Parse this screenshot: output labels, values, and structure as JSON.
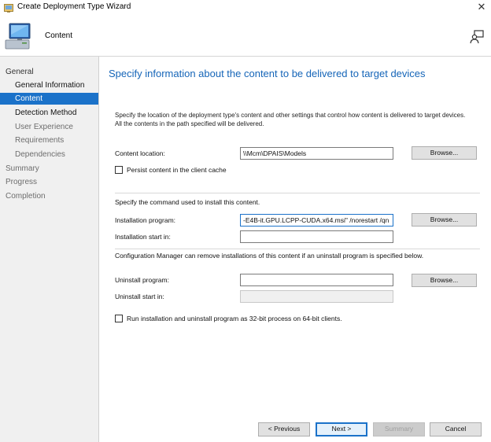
{
  "window": {
    "title": "Create Deployment Type Wizard",
    "close_glyph": "✕"
  },
  "header": {
    "title": "Content",
    "icon": "computer-icon",
    "assist_icon": "help-person-icon"
  },
  "sidebar": {
    "items": [
      {
        "label": "General"
      },
      {
        "label": "General Information"
      },
      {
        "label": "Content"
      },
      {
        "label": "Detection Method"
      },
      {
        "label": "User Experience"
      },
      {
        "label": "Requirements"
      },
      {
        "label": "Dependencies"
      },
      {
        "label": "Summary"
      },
      {
        "label": "Progress"
      },
      {
        "label": "Completion"
      }
    ],
    "active": "Content"
  },
  "main": {
    "heading": "Specify information about the content to be delivered to target devices",
    "description": "Specify the location of the deployment type's content and other settings that control how content is delivered to target devices. All the contents in the path specified will be delivered.",
    "content_location": {
      "label": "Content location:",
      "value": "\\\\Mcm\\DPAIS\\Models",
      "browse": "Browse..."
    },
    "persist_cache": {
      "label": "Persist content in the client cache",
      "checked": false
    },
    "install_section_label": "Specify the command used to install this content.",
    "installation_program": {
      "label": "Installation program:",
      "value": "-E4B-it.GPU.LCPP-CUDA.x64.msi\" /norestart /qn",
      "browse": "Browse..."
    },
    "installation_start_in": {
      "label": "Installation start in:",
      "value": ""
    },
    "uninstall_info": "Configuration Manager can remove installations of this content if an uninstall program is specified below.",
    "uninstall_program": {
      "label": "Uninstall program:",
      "value": "",
      "browse": "Browse..."
    },
    "uninstall_start_in": {
      "label": "Uninstall start in:",
      "value": ""
    },
    "run_32bit": {
      "label": "Run installation and uninstall program as 32-bit process on 64-bit clients.",
      "checked": false
    }
  },
  "footer": {
    "previous": "< Previous",
    "next": "Next >",
    "summary": "Summary",
    "cancel": "Cancel"
  },
  "colors": {
    "accent": "#1b72c9",
    "heading": "#1565b8",
    "sidebar_bg": "#f0f0f0"
  }
}
